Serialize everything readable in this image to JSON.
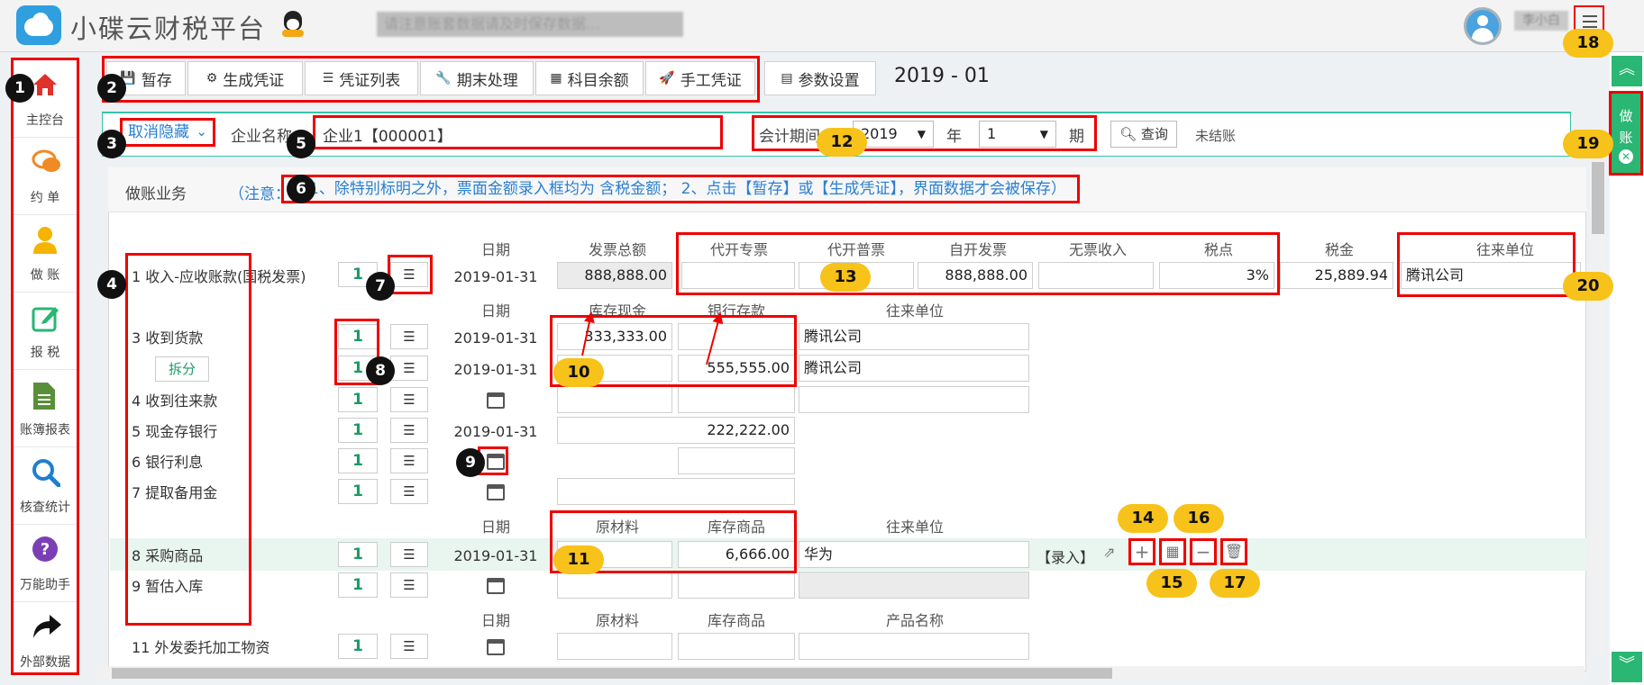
{
  "header": {
    "brand": "小碟云财税平台",
    "notice": "请注意账套数据请及时保存数据…",
    "username": "李小白"
  },
  "leftnav": [
    {
      "label": "主控台",
      "icon": "home-icon"
    },
    {
      "label": "约 单",
      "icon": "chat-icon"
    },
    {
      "label": "做 账",
      "icon": "user-icon"
    },
    {
      "label": "报 税",
      "icon": "edit-icon"
    },
    {
      "label": "账簿报表",
      "icon": "document-icon"
    },
    {
      "label": "核查统计",
      "icon": "search-icon"
    },
    {
      "label": "万能助手",
      "icon": "question-icon"
    },
    {
      "label": "外部数据",
      "icon": "share-arrow-icon"
    }
  ],
  "toolbar": {
    "save": "暂存",
    "generate": "生成凭证",
    "voucher_list": "凭证列表",
    "period_end": "期末处理",
    "account_balance": "科目余额",
    "manual_voucher": "手工凭证",
    "settings": "参数设置",
    "period": "2019 - 01"
  },
  "companybar": {
    "cancel_hide": "取消隐藏",
    "company_label": "企业名称",
    "company_value": "企业1【000001】",
    "period_label": "会计期间",
    "year_value": "2019",
    "year_label": "年",
    "period_value": "1",
    "period_unit": "期",
    "query": "查询",
    "status": "未结账"
  },
  "panel": {
    "title": "做账业务",
    "note_prefix": "（注意：",
    "note": "1、除特别标明之外，票面金额录入框均为 含税金额；  2、点击【暂存】或【生成凭证】，界面数据才会被保存）"
  },
  "section1": {
    "headers": {
      "date": "日期",
      "invoice_total": "发票总额",
      "special_agent": "代开专票",
      "general_agent": "代开普票",
      "self_issued": "自开发票",
      "no_invoice": "无票收入",
      "tax_rate": "税点",
      "tax": "税金",
      "counterparty": "往来单位"
    },
    "row": {
      "label": "1  收入-应收账款(国税发票)",
      "count": "1",
      "date": "2019-01-31",
      "invoice_total": "888,888.00",
      "self_issued": "888,888.00",
      "tax_rate": "3%",
      "tax": "25,889.94",
      "counterparty": "腾讯公司"
    }
  },
  "section2": {
    "headers": {
      "date": "日期",
      "cash": "库存现金",
      "bank": "银行存款",
      "counterparty": "往来单位"
    },
    "rows": [
      {
        "label": "3  收到货款",
        "count": "1",
        "date": "2019-01-31",
        "cash": "333,333.00",
        "bank": "",
        "counterparty": "腾讯公司"
      },
      {
        "label": "",
        "count": "1",
        "date": "2019-01-31",
        "cash": "",
        "bank": "555,555.00",
        "counterparty": "腾讯公司"
      },
      {
        "label": "4  收到往来款",
        "count": "1",
        "date": ""
      },
      {
        "label": "5  现金存银行",
        "count": "1",
        "date": "2019-01-31",
        "cash": "222,222.00"
      },
      {
        "label": "6  银行利息",
        "count": "1",
        "date": ""
      },
      {
        "label": "7  提取备用金",
        "count": "1",
        "date": ""
      }
    ],
    "split": "拆分"
  },
  "section3": {
    "headers": {
      "date": "日期",
      "raw": "原材料",
      "goods": "库存商品",
      "counterparty": "往来单位"
    },
    "rows": [
      {
        "label": "8  采购商品",
        "count": "1",
        "date": "2019-01-31",
        "goods": "6,666.00",
        "counterparty": "华为"
      },
      {
        "label": "9  暂估入库",
        "count": "1",
        "date": ""
      }
    ],
    "entry": "【录入】"
  },
  "section4": {
    "headers": {
      "date": "日期",
      "raw": "原材料",
      "goods": "库存商品",
      "product": "产品名称"
    },
    "rows": [
      {
        "label": "11  外发委托加工物资",
        "count": "1",
        "date": ""
      }
    ]
  },
  "rail": {
    "tab_line1": "做",
    "tab_line2": "账"
  },
  "markers": [
    "1",
    "2",
    "3",
    "4",
    "5",
    "6",
    "7",
    "8",
    "9",
    "10",
    "11",
    "12",
    "13",
    "14",
    "15",
    "16",
    "17",
    "18",
    "19",
    "20"
  ],
  "colors": {
    "accent_green": "#2ab673",
    "annotation_red": "#ee0000",
    "marker_yellow": "#f7c21a",
    "link_blue": "#2a7fd0"
  }
}
